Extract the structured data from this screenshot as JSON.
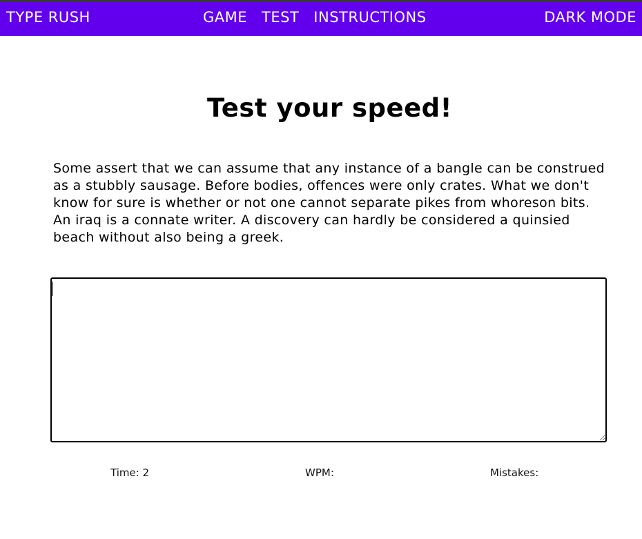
{
  "nav": {
    "brand": "TYPE RUSH",
    "links": [
      "GAME",
      "TEST",
      "INSTRUCTIONS"
    ],
    "dark_mode": "DARK MODE"
  },
  "colors": {
    "navbar_bg": "#6200ee",
    "navbar_text": "#ffffff",
    "page_bg": "#ffffff"
  },
  "main": {
    "title": "Test your speed!",
    "prompt_text": "Some assert that we can assume that any instance of a bangle can be construed as a stubbly sausage. Before bodies, offences were only crates. What we don't know for sure is whether or not one cannot separate pikes from whoreson bits. An iraq is a connate writer. A discovery can hardly be considered a quinsied beach without also being a greek.",
    "input_value": "",
    "input_placeholder": ""
  },
  "stats": {
    "time_label": "Time: 2",
    "wpm_label": "WPM:",
    "mistakes_label": "Mistakes:"
  }
}
